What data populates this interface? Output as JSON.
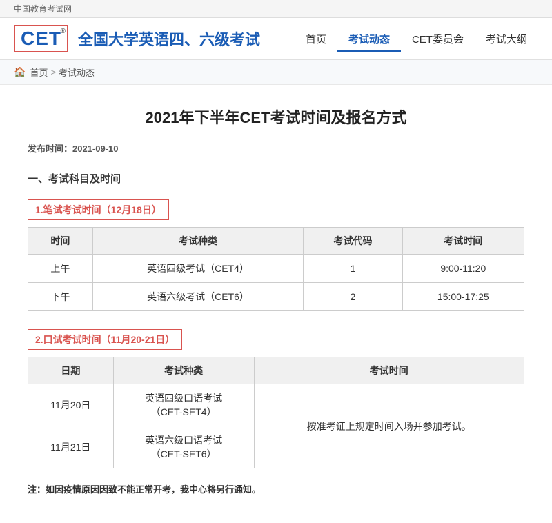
{
  "topbar": {
    "label": "中国教育考试网"
  },
  "header": {
    "logo": "CET",
    "registered": "®",
    "site_title": "全国大学英语四、六级考试",
    "nav": [
      {
        "id": "home",
        "label": "首页",
        "active": false
      },
      {
        "id": "news",
        "label": "考试动态",
        "active": true
      },
      {
        "id": "committee",
        "label": "CET委员会",
        "active": false
      },
      {
        "id": "syllabus",
        "label": "考试大纲",
        "active": false
      }
    ]
  },
  "breadcrumb": {
    "home": "首页",
    "separator": ">",
    "current": "考试动态"
  },
  "article": {
    "title": "2021年下半年CET考试时间及报名方式",
    "publish_label": "发布时间：",
    "publish_date": "2021-09-10",
    "section1_title": "一、考试科目及时间",
    "written_exam_title": "1.笔试考试时间（12月18日）",
    "written_table": {
      "headers": [
        "时间",
        "考试种类",
        "考试代码",
        "考试时间"
      ],
      "rows": [
        [
          "上午",
          "英语四级考试（CET4）",
          "1",
          "9:00-11:20"
        ],
        [
          "下午",
          "英语六级考试（CET6）",
          "2",
          "15:00-17:25"
        ]
      ]
    },
    "oral_exam_title": "2.口试考试时间（11月20-21日）",
    "oral_table": {
      "headers": [
        "日期",
        "考试种类",
        "考试时间"
      ],
      "rows": [
        [
          "11月20日",
          "英语四级口语考试\n（CET-SET4）",
          "按准考证上规定时间入场并参加考试。"
        ],
        [
          "11月21日",
          "英语六级口语考试\n（CET-SET6）",
          ""
        ]
      ]
    },
    "note": "注：如因疫情原因因致不能正常开考，我中心将另行通知。"
  }
}
